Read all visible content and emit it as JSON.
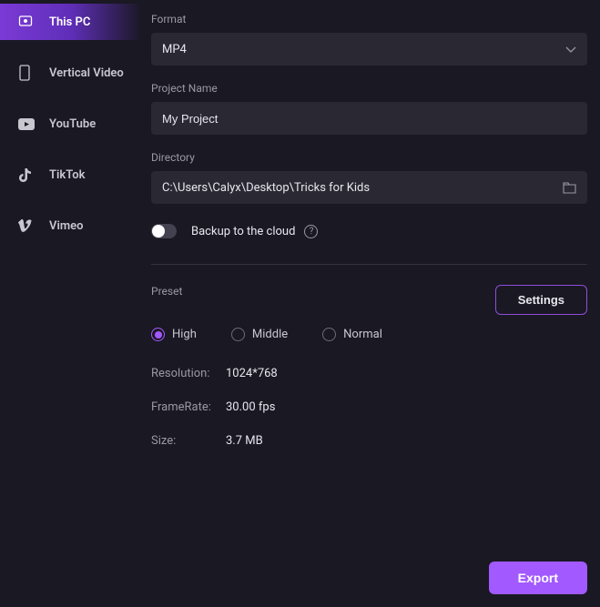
{
  "sidebar": {
    "items": [
      {
        "label": "This PC"
      },
      {
        "label": "Vertical Video"
      },
      {
        "label": "YouTube"
      },
      {
        "label": "TikTok"
      },
      {
        "label": "Vimeo"
      }
    ]
  },
  "format": {
    "label": "Format",
    "value": "MP4"
  },
  "project": {
    "label": "Project Name",
    "value": "My Project"
  },
  "directory": {
    "label": "Directory",
    "value": "C:\\Users\\Calyx\\Desktop\\Tricks for Kids"
  },
  "backup": {
    "label": "Backup to the cloud",
    "enabled": false
  },
  "preset": {
    "label": "Preset",
    "settings_btn": "Settings",
    "options": [
      {
        "label": "High",
        "selected": true
      },
      {
        "label": "Middle",
        "selected": false
      },
      {
        "label": "Normal",
        "selected": false
      }
    ]
  },
  "info": {
    "resolution_key": "Resolution:",
    "resolution_val": "1024*768",
    "framerate_key": "FrameRate:",
    "framerate_val": "30.00 fps",
    "size_key": "Size:",
    "size_val": "3.7 MB"
  },
  "export_btn": "Export"
}
